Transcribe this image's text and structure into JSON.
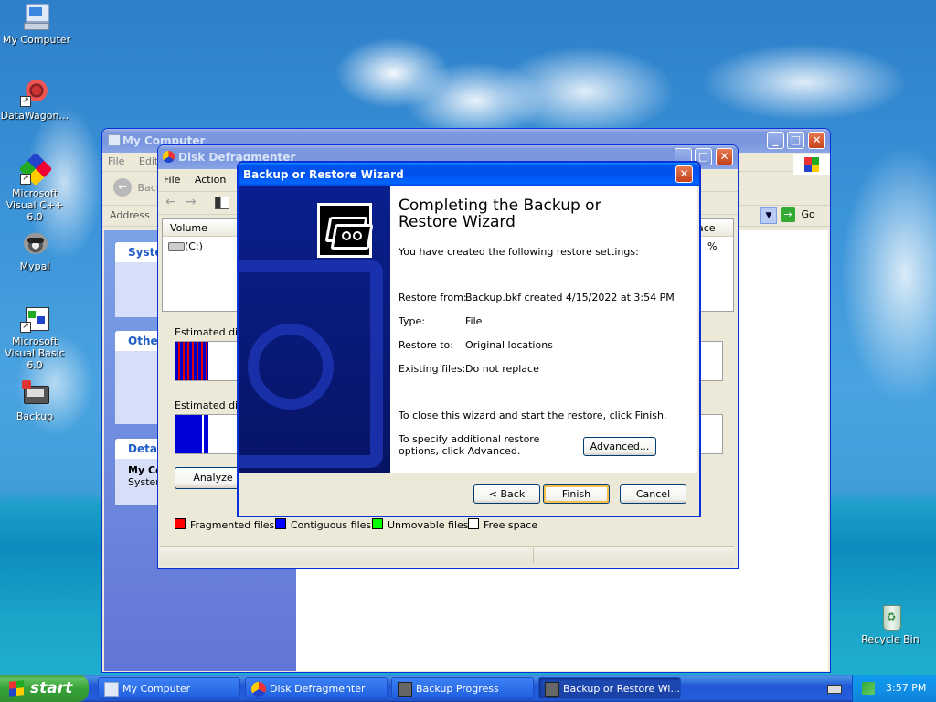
{
  "desktop_icons": [
    {
      "label": "My Computer",
      "icon": "computer-icon"
    },
    {
      "label": "DataWagon…",
      "icon": "datawagon-icon"
    },
    {
      "label": "Microsoft Visual C++ 6.0",
      "icon": "visual-cpp-icon"
    },
    {
      "label": "Mypal",
      "icon": "mypal-icon"
    },
    {
      "label": "Microsoft Visual Basic 6.0",
      "icon": "visual-basic-icon"
    },
    {
      "label": "Backup",
      "icon": "backup-icon"
    },
    {
      "label": "Recycle Bin",
      "icon": "recycle-bin-icon"
    }
  ],
  "my_computer": {
    "title": "My Computer",
    "menu": [
      "File",
      "Edit"
    ],
    "back_label": "Back",
    "address_label": "Address",
    "go_label": "Go",
    "panels": [
      "System",
      "Other",
      "Details"
    ],
    "details_text": [
      "My Co",
      "System"
    ]
  },
  "defrag": {
    "title": "Disk Defragmenter",
    "menu": [
      "File",
      "Action"
    ],
    "col_volume": "Volume",
    "col_space": "ace",
    "volume_name": "(C:)",
    "percent": "%",
    "estimated_before": "Estimated disk",
    "estimated_after": "Estimated disk",
    "analyze_button": "Analyze",
    "legend": [
      {
        "label": "Fragmented files",
        "color": "#ff0000"
      },
      {
        "label": "Contiguous files",
        "color": "#0000ff"
      },
      {
        "label": "Unmovable files",
        "color": "#00ff00"
      },
      {
        "label": "Free space",
        "color": "#ffffff"
      }
    ]
  },
  "wizard": {
    "title": "Backup or Restore Wizard",
    "heading": "Completing the Backup or Restore Wizard",
    "intro": "You have created the following restore settings:",
    "settings": [
      {
        "label": "Restore from:",
        "value": "Backup.bkf created 4/15/2022 at 3:54 PM"
      },
      {
        "label": "Type:",
        "value": "File"
      },
      {
        "label": "Restore to:",
        "value": "Original locations"
      },
      {
        "label": "Existing files:",
        "value": "Do not replace"
      }
    ],
    "finish_note": "To close this wizard and start the restore, click Finish.",
    "advanced_note": "To specify additional restore options, click Advanced.",
    "advanced_button": "Advanced...",
    "back_button": "< Back",
    "finish_button": "Finish",
    "cancel_button": "Cancel"
  },
  "taskbar": {
    "start_label": "start",
    "tasks": [
      {
        "label": "My Computer",
        "active": false
      },
      {
        "label": "Disk Defragmenter",
        "active": false
      },
      {
        "label": "Backup Progress",
        "active": false
      },
      {
        "label": "Backup or Restore Wi...",
        "active": true
      }
    ],
    "clock": "3:57 PM"
  }
}
